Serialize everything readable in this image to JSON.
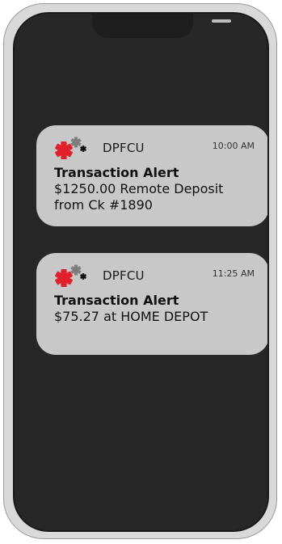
{
  "colors": {
    "accent_red": "#e0202a",
    "gray_star": "#7d7d7d",
    "notification_bg": "#c8c8c8",
    "screen_bg": "#272727"
  },
  "notifications": [
    {
      "app_name": "DPFCU",
      "time": "10:00 AM",
      "title": "Transaction Alert",
      "body": "$1250.00 Remote Deposit from Ck #1890",
      "icon": "medical-asterisk-logo-icon"
    },
    {
      "app_name": "DPFCU",
      "time": "11:25 AM",
      "title": "Transaction Alert",
      "body": "$75.27 at HOME DEPOT",
      "icon": "medical-asterisk-logo-icon"
    }
  ]
}
